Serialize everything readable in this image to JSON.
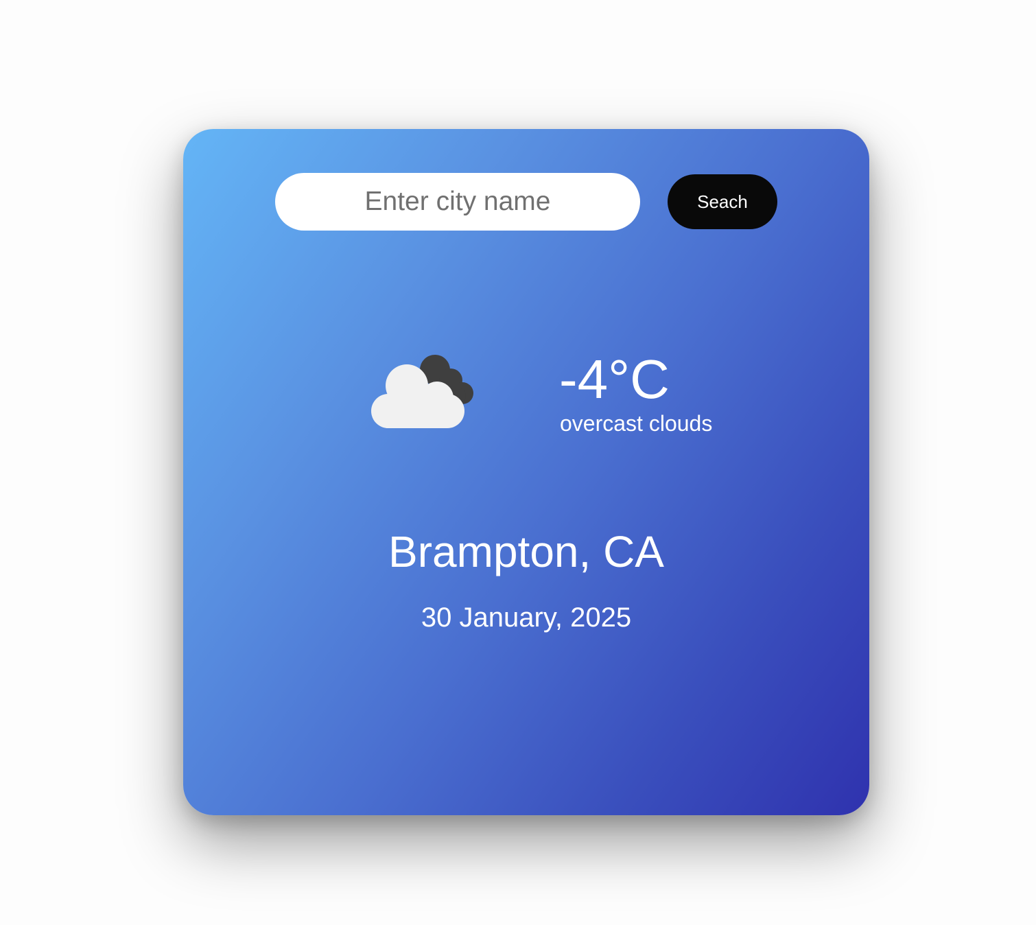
{
  "search": {
    "placeholder": "Enter city name",
    "value": "",
    "button_label": "Seach"
  },
  "weather": {
    "icon": "cloud-icon",
    "temperature": "-4°C",
    "description": "overcast clouds",
    "city": "Brampton, CA",
    "date": "30 January, 2025"
  },
  "colors": {
    "gradient_start": "#64b5f6",
    "gradient_end": "#2f32ae",
    "button_bg": "#090909",
    "text": "#ffffff"
  }
}
